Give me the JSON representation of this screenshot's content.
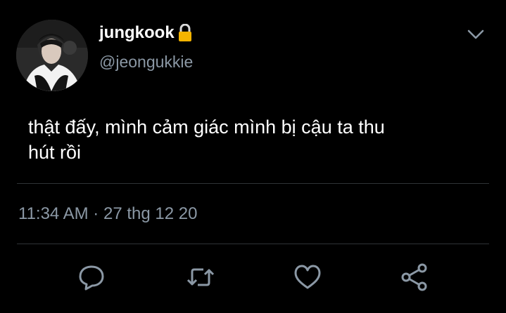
{
  "user": {
    "name": "jungkook",
    "handle": "@jeongukkie",
    "verified_icon": "lock-icon",
    "avatar_icon": "profile-photo"
  },
  "tweet": {
    "text_line1": "thật đấy, mình cảm giác mình bị cậu ta thu",
    "text_line2": "hút rồi"
  },
  "meta": {
    "time": "11:34 AM",
    "separator": "·",
    "date": "27 thg 12 20"
  },
  "actions": {
    "reply_icon": "reply-icon",
    "retweet_icon": "retweet-icon",
    "like_icon": "heart-icon",
    "share_icon": "share-icon"
  },
  "colors": {
    "background": "#000000",
    "text": "#ffffff",
    "secondary": "#8b98a5",
    "divider": "#2f3336",
    "lock": "#f5b400"
  }
}
